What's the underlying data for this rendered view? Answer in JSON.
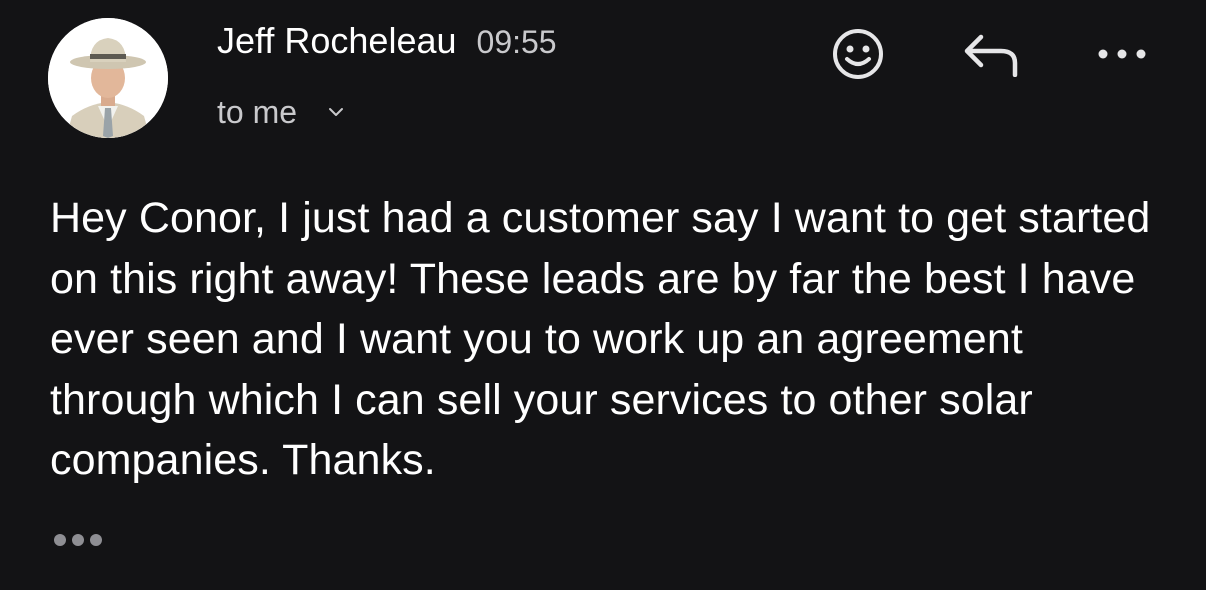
{
  "email": {
    "sender_name": "Jeff Rocheleau",
    "time": "09:55",
    "recipient": "to me",
    "body": "Hey Conor, I just had a customer say I want to get started on this right away! These leads are by far the best I have ever seen and I want you to work up an agreement through which I can sell your services to other solar companies. Thanks."
  },
  "icons": {
    "avatar": "sender-avatar-photo",
    "recipient_toggle": "chevron-down-icon",
    "emoji": "emoji-reaction-icon",
    "reply": "reply-arrow-icon",
    "more": "more-options-icon",
    "trimmed_content": "show-trimmed-content-icon"
  },
  "colors": {
    "background": "#131315",
    "primary_text": "#ffffff",
    "secondary_text": "#c9c9cc",
    "icon": "#e6e6e8",
    "trimmed_dots": "#8e8e93"
  }
}
